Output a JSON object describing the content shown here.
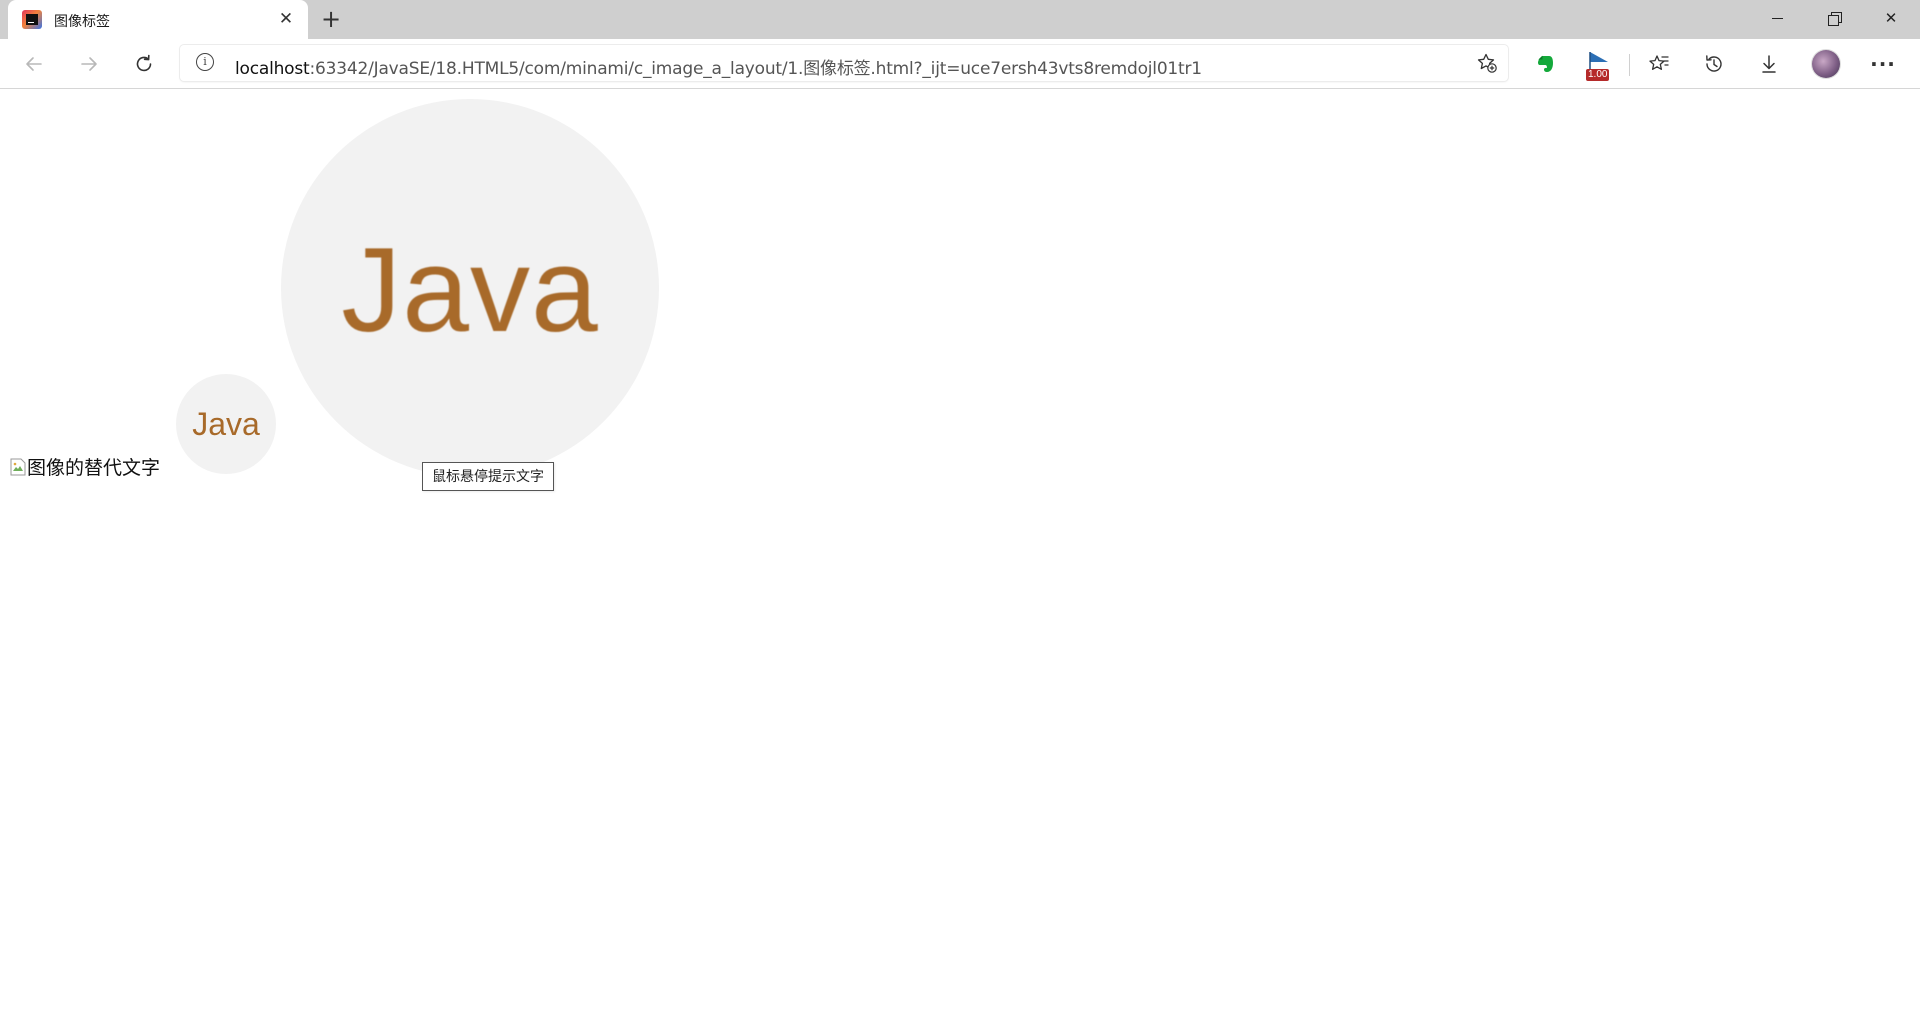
{
  "browser": {
    "tab": {
      "title": "图像标签",
      "close_glyph": "✕",
      "favicon_icon": "intellij-idea-icon"
    },
    "new_tab_glyph": "+",
    "window_controls": {
      "minimize_icon": "minimize-icon",
      "restore_icon": "restore-icon",
      "close_glyph": "✕"
    },
    "toolbar": {
      "back_icon": "arrow-left-icon",
      "forward_icon": "arrow-right-icon",
      "reload_icon": "reload-icon",
      "address": {
        "info_glyph": "i",
        "host": "localhost",
        "path": ":63342/JavaSE/18.HTML5/com/minami/c_image_a_layout/1.图像标签.html?_ijt=uce7ersh43vts8remdojl01tr1"
      },
      "extensions": {
        "evernote_icon": "evernote-icon",
        "badge_value": "1.00"
      },
      "more_glyph": "···"
    }
  },
  "page": {
    "broken_image_alt": "图像的替代文字",
    "java_logo_small_text": "Java",
    "java_logo_large_text": "Java",
    "tooltip_text": "鼠标悬停提示文字"
  },
  "colors": {
    "java_text": "#a86a2a",
    "logo_bg": "#f2f2f2",
    "tabstrip_bg": "#cfcfcf",
    "evernote_green": "#14a93b",
    "badge_red": "#b52a2a"
  }
}
